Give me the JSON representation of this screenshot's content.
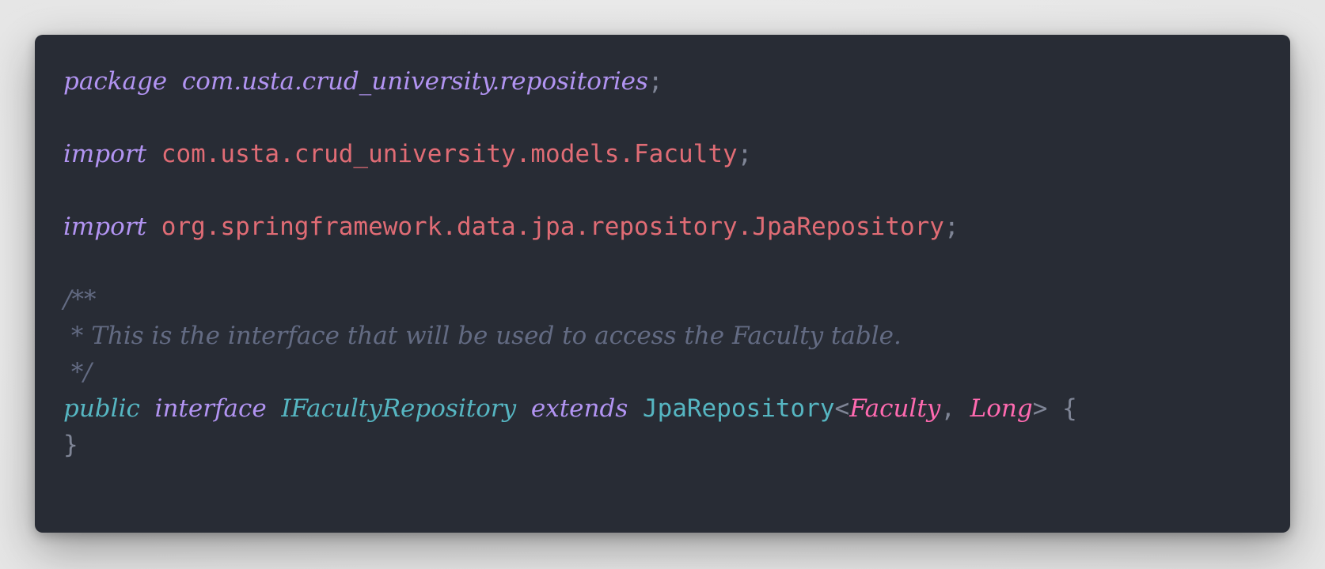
{
  "code": {
    "line1": {
      "keyword": "package",
      "name": "com.usta.crud_university.repositories",
      "semicolon": ";"
    },
    "line3": {
      "keyword": "import",
      "name": "com.usta.crud_university.models.Faculty",
      "semicolon": ";"
    },
    "line5": {
      "keyword": "import",
      "name": "org.springframework.data.jpa.repository.JpaRepository",
      "semicolon": ";"
    },
    "comment": {
      "open": "/**",
      "body": " * This is the interface that will be used to access the Faculty table.",
      "close": " */"
    },
    "declaration": {
      "modifier": "public",
      "keyword": "interface",
      "name": "IFacultyRepository",
      "extends": "extends",
      "super_type": "JpaRepository",
      "lt": "<",
      "generic1": "Faculty",
      "comma": ", ",
      "generic2": "Long",
      "gt": ">",
      "brace_open": "{"
    },
    "closing_brace": "}"
  },
  "colors": {
    "background": "#282c35",
    "keyword": "#b294f2",
    "import_path": "#e06c75",
    "comment": "#636b83",
    "type": "#56b6c2",
    "generic": "#ff6ab0",
    "punctuation": "#7f8596"
  }
}
